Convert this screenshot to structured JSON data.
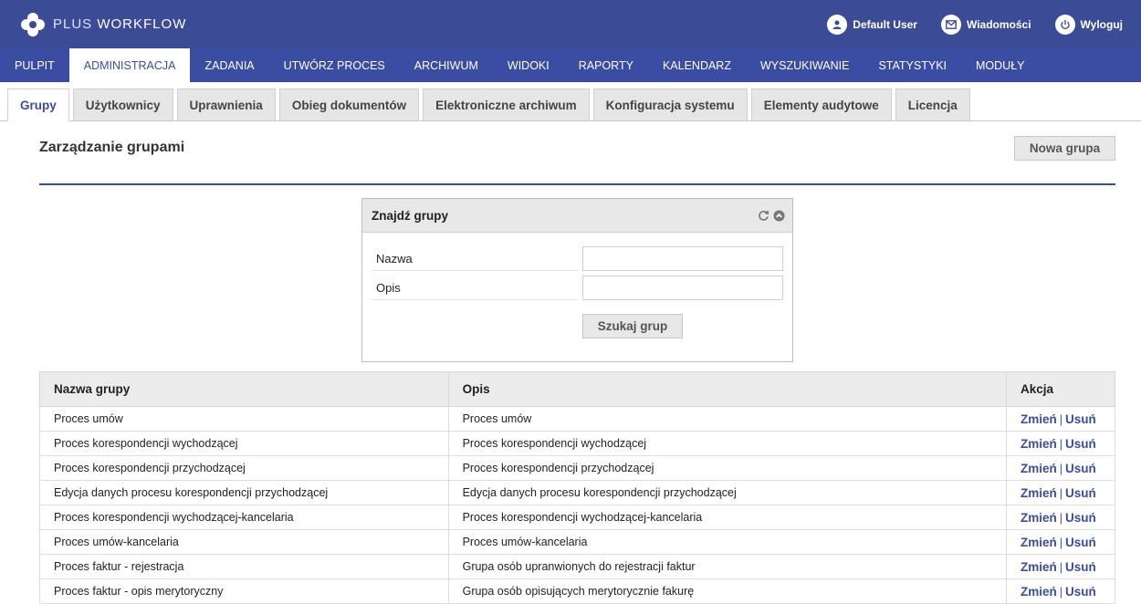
{
  "header": {
    "logo_plus": "PLUS",
    "logo_workflow": "WORKFLOW",
    "user": "Default User",
    "messages": "Wiadomości",
    "logout": "Wyloguj"
  },
  "mainnav": {
    "items": [
      "PULPIT",
      "ADMINISTRACJA",
      "ZADANIA",
      "UTWÓRZ PROCES",
      "ARCHIWUM",
      "WIDOKI",
      "RAPORTY",
      "KALENDARZ",
      "WYSZUKIWANIE",
      "STATYSTYKI",
      "MODUŁY"
    ],
    "active": "ADMINISTRACJA"
  },
  "subtabs": {
    "items": [
      "Grupy",
      "Użytkownicy",
      "Uprawnienia",
      "Obieg dokumentów",
      "Elektroniczne archiwum",
      "Konfiguracja systemu",
      "Elementy audytowe",
      "Licencja"
    ],
    "active": "Grupy"
  },
  "page": {
    "title": "Zarządzanie grupami",
    "new_group_label": "Nowa grupa"
  },
  "search": {
    "title": "Znajdź grupy",
    "name_label": "Nazwa",
    "name_value": "",
    "desc_label": "Opis",
    "desc_value": "",
    "button_label": "Szukaj grup"
  },
  "table": {
    "headers": [
      "Nazwa grupy",
      "Opis",
      "Akcja"
    ],
    "action_edit": "Zmień",
    "action_sep": "|",
    "action_delete": "Usuń",
    "rows": [
      [
        "Proces umów",
        "Proces umów"
      ],
      [
        "Proces korespondencji wychodzącej",
        "Proces korespondencji wychodzącej"
      ],
      [
        "Proces korespondencji przychodzącej",
        "Proces korespondencji przychodzącej"
      ],
      [
        "Edycja danych procesu korespondencji przychodzącej",
        "Edycja danych procesu korespondencji przychodzącej"
      ],
      [
        "Proces korespondencji wychodzącej-kancelaria",
        "Proces korespondencji wychodzącej-kancelaria"
      ],
      [
        "Proces umów-kancelaria",
        "Proces umów-kancelaria"
      ],
      [
        "Proces faktur - rejestracja",
        "Grupa osób upranwionych do rejestracji faktur"
      ],
      [
        "Proces faktur - opis merytoryczny",
        "Grupa osób opisujących merytorycznie fakurę"
      ]
    ]
  },
  "colors": {
    "header_bg": "#3c4b96",
    "nav_bg": "#3a4da3",
    "accent": "#3a4da3"
  }
}
